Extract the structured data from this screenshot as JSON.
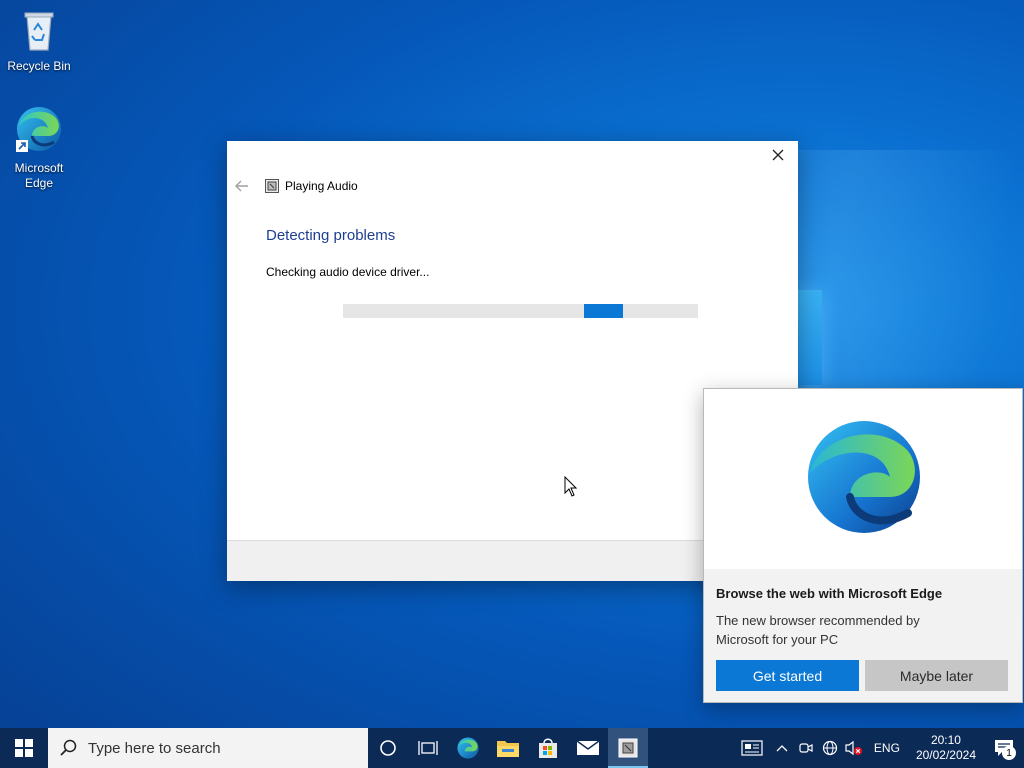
{
  "desktop": {
    "icons": [
      {
        "label": "Recycle Bin"
      },
      {
        "label": "Microsoft Edge"
      }
    ]
  },
  "troubleshooter": {
    "header_title": "Playing Audio",
    "heading": "Detecting problems",
    "status": "Checking audio device driver...",
    "progress_chunk_start": 0.68,
    "progress_chunk_width": 0.11
  },
  "edge_popup": {
    "title": "Browse the web with Microsoft Edge",
    "body": "The new browser recommended by Microsoft for your PC",
    "primary_button": "Get started",
    "secondary_button": "Maybe later"
  },
  "taskbar": {
    "search_placeholder": "Type here to search",
    "pinned": [
      "cortana-icon",
      "task-view-icon",
      "edge-icon",
      "file-explorer-icon",
      "store-icon",
      "mail-icon",
      "troubleshooter-icon"
    ],
    "active": "troubleshooter-icon",
    "language": "ENG",
    "time": "20:10",
    "date": "20/02/2024",
    "notification_count": "1"
  },
  "colors": {
    "accent": "#0a78d4",
    "heading": "#1e3f91",
    "taskbar": "#0c2a56"
  }
}
